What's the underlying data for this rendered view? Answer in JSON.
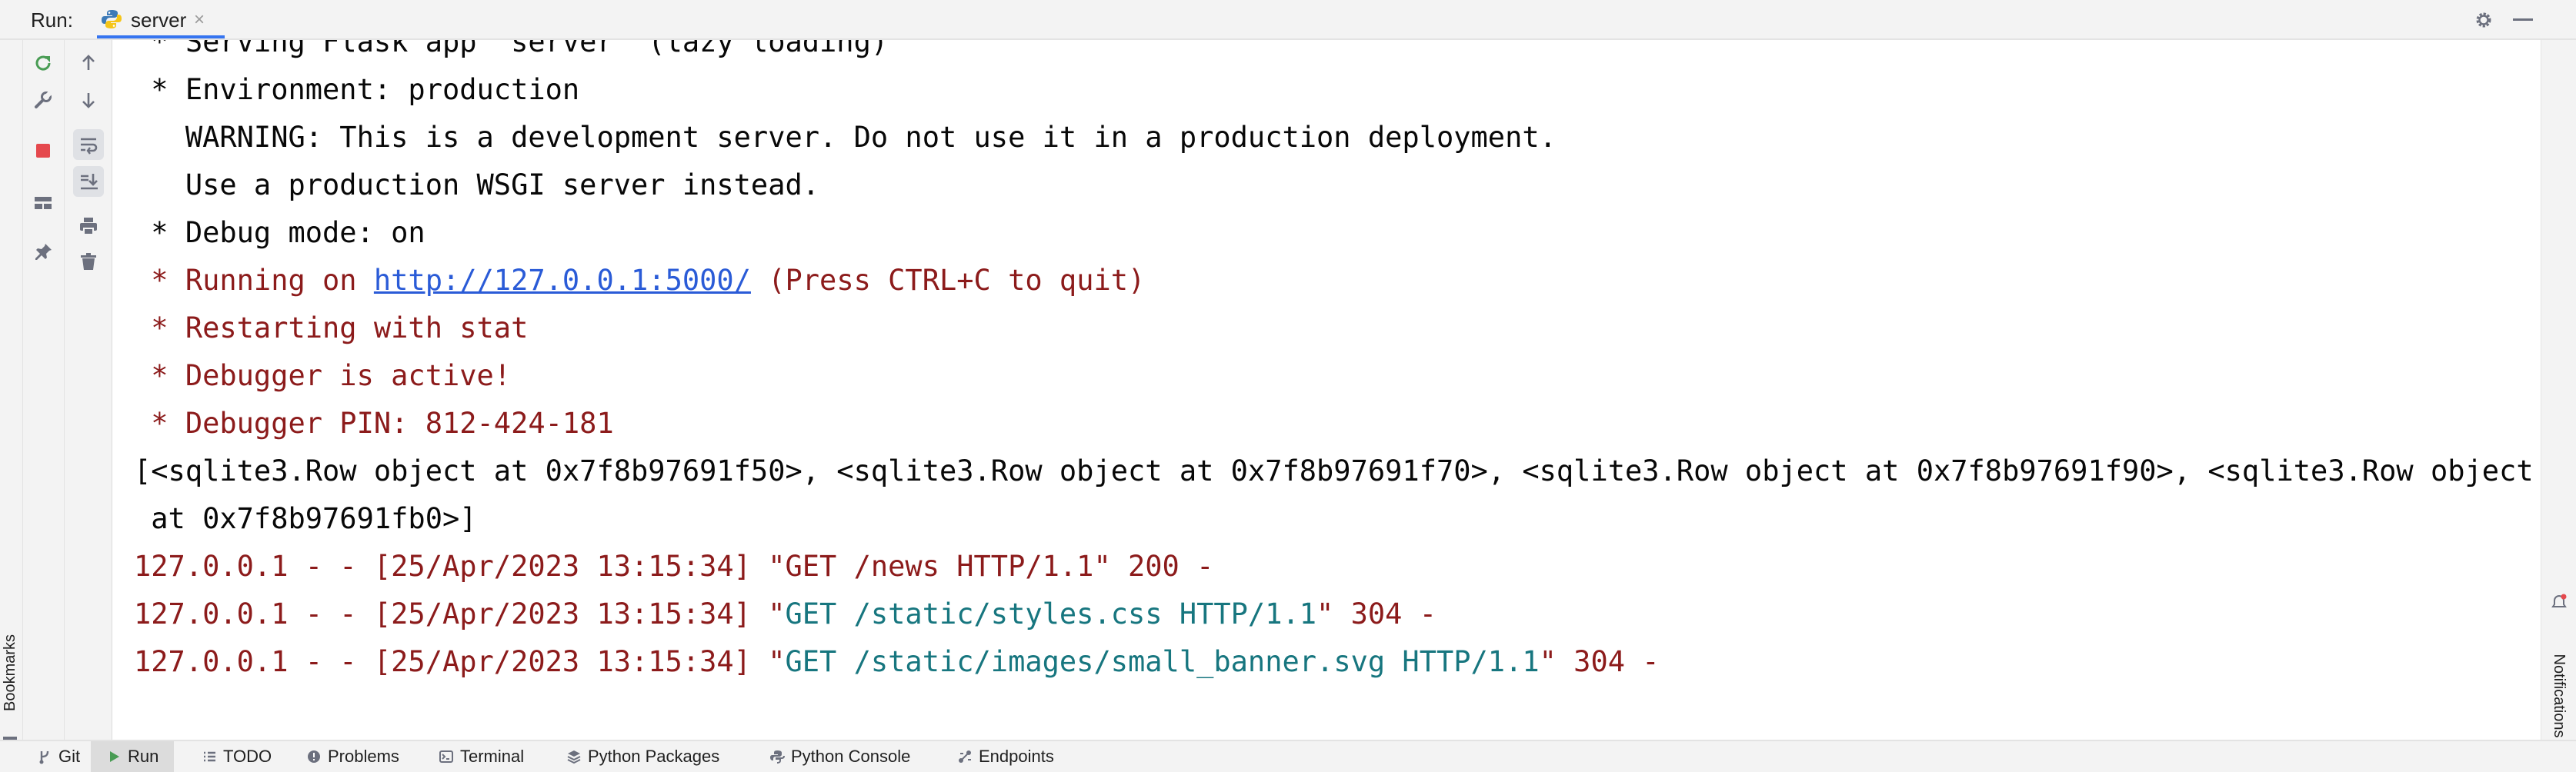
{
  "header": {
    "run_label": "Run:",
    "tab": {
      "label": "server",
      "icon": "python-icon",
      "close": "×"
    },
    "actions": [
      "gear-icon",
      "minimize-icon"
    ]
  },
  "left_stripe": {
    "bookmarks_label": "Bookmarks"
  },
  "right_stripe": {
    "notifications_label": "Notifications"
  },
  "toolbar_primary": [
    "rerun-icon",
    "wrench-icon",
    "stop-icon",
    "layout-icon",
    "pin-icon"
  ],
  "toolbar_secondary": [
    "arrow-up-icon",
    "arrow-down-icon",
    "soft-wrap-icon",
    "scroll-to-end-icon",
    "print-icon",
    "trash-icon"
  ],
  "console": {
    "lines": [
      {
        "text": " * Serving Flask app 'server' (lazy loading)",
        "color": "black"
      },
      {
        "text": " * Environment: production",
        "color": "black"
      },
      {
        "text": "   WARNING: This is a development server. Do not use it in a production deployment.",
        "color": "black"
      },
      {
        "text": "   Use a production WSGI server instead.",
        "color": "black"
      },
      {
        "text": " * Debug mode: on",
        "color": "black"
      },
      {
        "segments": [
          {
            "text": " * Running on ",
            "color": "red"
          },
          {
            "text": "http://127.0.0.1:5000/",
            "color": "link"
          },
          {
            "text": " (Press CTRL+C to quit)",
            "color": "red"
          }
        ]
      },
      {
        "text": " * Restarting with stat",
        "color": "red"
      },
      {
        "text": " * Debugger is active!",
        "color": "red"
      },
      {
        "text": " * Debugger PIN: 812-424-181",
        "color": "red"
      },
      {
        "text": "[<sqlite3.Row object at 0x7f8b97691f50>, <sqlite3.Row object at 0x7f8b97691f70>, <sqlite3.Row object at 0x7f8b97691f90>, <sqlite3.Row object",
        "color": "black"
      },
      {
        "text": " at 0x7f8b97691fb0>]",
        "color": "black"
      },
      {
        "segments": [
          {
            "text": "127.0.0.1 - - [25/Apr/2023 13:15:34] \"GET /news HTTP/1.1\" 200 -",
            "color": "red"
          }
        ]
      },
      {
        "segments": [
          {
            "text": "127.0.0.1 - - [25/Apr/2023 13:15:34] \"",
            "color": "red"
          },
          {
            "text": "GET /static/styles.css HTTP/1.1",
            "color": "teal"
          },
          {
            "text": "\" 304 -",
            "color": "red"
          }
        ]
      },
      {
        "segments": [
          {
            "text": "127.0.0.1 - - [25/Apr/2023 13:15:34] \"",
            "color": "red"
          },
          {
            "text": "GET /static/images/small_banner.svg HTTP/1.1",
            "color": "teal"
          },
          {
            "text": "\" 304 -",
            "color": "red"
          }
        ]
      }
    ]
  },
  "bottom_bar": [
    {
      "label": "Git",
      "icon": "git-branch-icon",
      "active": false
    },
    {
      "label": "Run",
      "icon": "run-icon",
      "active": true
    },
    {
      "label": "TODO",
      "icon": "todo-list-icon",
      "active": false
    },
    {
      "label": "Problems",
      "icon": "problems-icon",
      "active": false
    },
    {
      "label": "Terminal",
      "icon": "terminal-icon",
      "active": false
    },
    {
      "label": "Python Packages",
      "icon": "packages-icon",
      "active": false
    },
    {
      "label": "Python Console",
      "icon": "python-console-icon",
      "active": false
    },
    {
      "label": "Endpoints",
      "icon": "endpoints-icon",
      "active": false
    }
  ],
  "colors": {
    "black": "#080808",
    "red": "#8c1b1b",
    "teal": "#17767f",
    "link": "#2a5bd7",
    "accent": "#3574f0",
    "stop": "#e5484d",
    "rerun": "#499c54"
  }
}
